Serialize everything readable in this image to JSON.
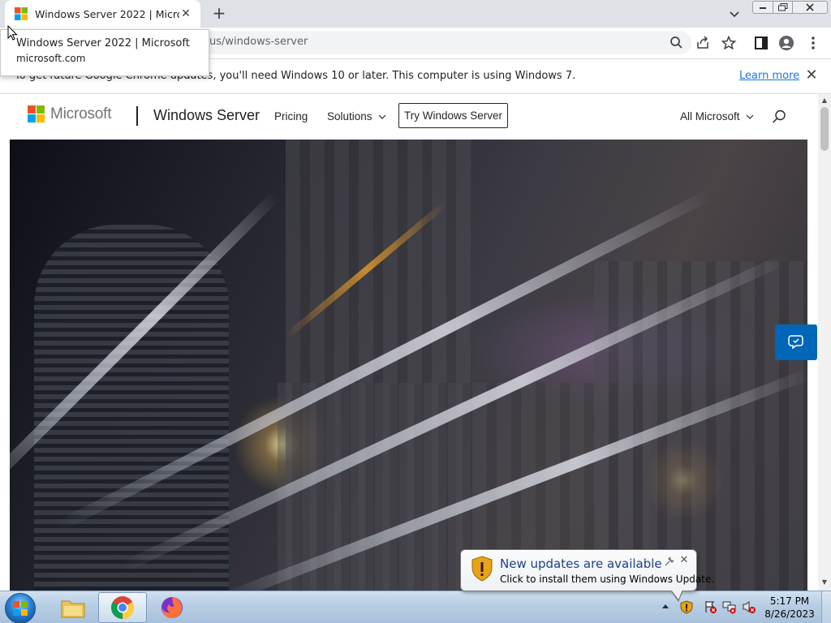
{
  "browser": {
    "tab": {
      "title": "Windows Server 2022 | Microsoft",
      "close_glyph": "✕"
    },
    "new_tab_glyph": "+",
    "tooltip": {
      "title": "Windows Server 2022 | Microsoft",
      "domain": "microsoft.com"
    },
    "omnibox": {
      "url_visible": "us/windows-server"
    },
    "infobar": {
      "text": "To get future Google Chrome updates, you'll need Windows 10 or later. This computer is using Windows 7.",
      "link": "Learn more",
      "close_glyph": "✕"
    }
  },
  "site": {
    "brand": "Microsoft",
    "product": "Windows Server",
    "nav": {
      "pricing": "Pricing",
      "solutions": "Solutions",
      "try_button": "Try Windows Server",
      "all_microsoft": "All Microsoft"
    },
    "colors": {
      "logo_red": "#f25022",
      "logo_green": "#7fba00",
      "logo_blue": "#00a4ef",
      "logo_yellow": "#ffb900",
      "accent": "#0067b8"
    }
  },
  "notification": {
    "title": "New updates are available",
    "text": "Click to install them using Windows Update."
  },
  "taskbar": {
    "clock_time": "5:17 PM",
    "clock_date": "8/26/2023"
  }
}
